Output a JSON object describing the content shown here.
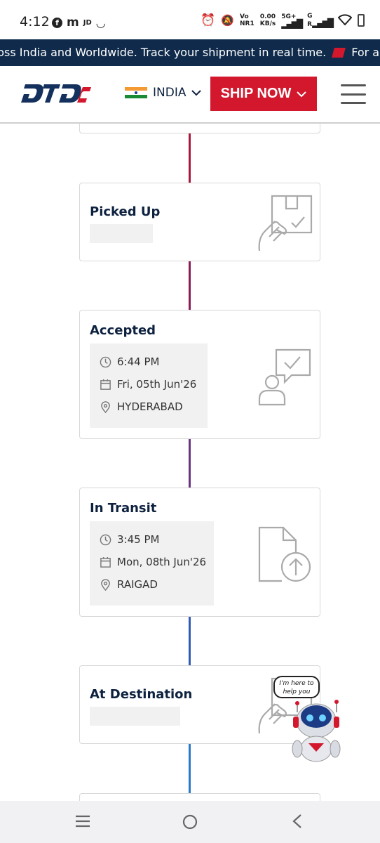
{
  "status_bar": {
    "time": "4:12",
    "left_icons": [
      "facebook-icon",
      "m-icon",
      "JD",
      "smile-icon"
    ],
    "network_lines": [
      "Vo",
      "NR1"
    ],
    "speed": "0.00",
    "speed_unit": "KB/s",
    "net_5g": "5G+",
    "net_g": "G",
    "net_r": "R"
  },
  "ticker": {
    "text": "ross India and Worldwide. Track your shipment in real time.",
    "text2": "For any c"
  },
  "header": {
    "logo_text": "DTDC",
    "country": "INDIA",
    "ship_now": "SHIP NOW"
  },
  "timeline": [
    {
      "title": "Picked Up",
      "icon": "hand-package-icon",
      "details": null
    },
    {
      "title": "Accepted",
      "icon": "person-check-chat-icon",
      "details": {
        "time": "6:44 PM",
        "date": "Fri, 05th Jun'26",
        "location": "HYDERABAD"
      }
    },
    {
      "title": "In Transit",
      "icon": "document-upload-icon",
      "details": {
        "time": "3:45 PM",
        "date": "Mon, 08th Jun'26",
        "location": "RAIGAD"
      }
    },
    {
      "title": "At Destination",
      "icon": "hand-package-icon",
      "details": null
    }
  ],
  "chatbot": {
    "bubble": "I'm here to help you"
  },
  "colors": {
    "brand_red": "#d3182d",
    "navy": "#0f2a4a",
    "line_red": "#9b1c4a",
    "line_purple": "#6b2f7c",
    "line_blue": "#2f5fb8"
  }
}
